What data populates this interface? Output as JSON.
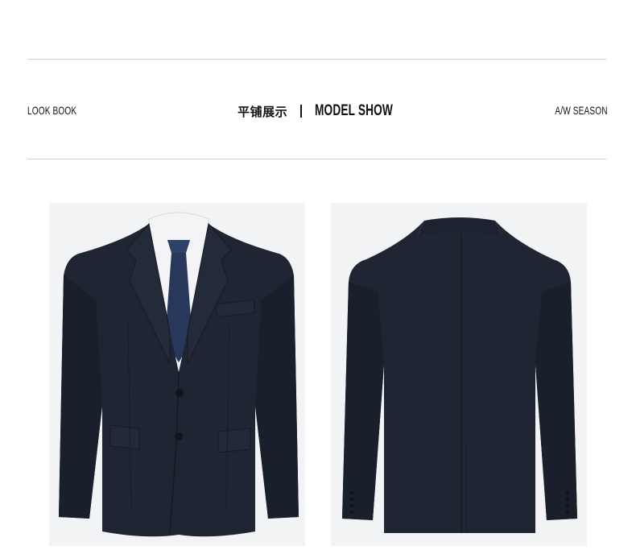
{
  "header": {
    "left_label": "LOOK BOOK",
    "center_title_cn": "平铺展示",
    "center_title_en": "MODEL SHOW",
    "right_label": "A/W SEASON"
  },
  "images": [
    {
      "name": "suit-jacket-front-image",
      "view": "front"
    },
    {
      "name": "suit-jacket-back-image",
      "view": "back"
    }
  ],
  "colors": {
    "background": "#ffffff",
    "rule": "#cfcfcf",
    "photo_bg": "#f2f3f5",
    "jacket": "#1f2533",
    "tie": "#27385a",
    "shirt": "#f4f4f6"
  }
}
